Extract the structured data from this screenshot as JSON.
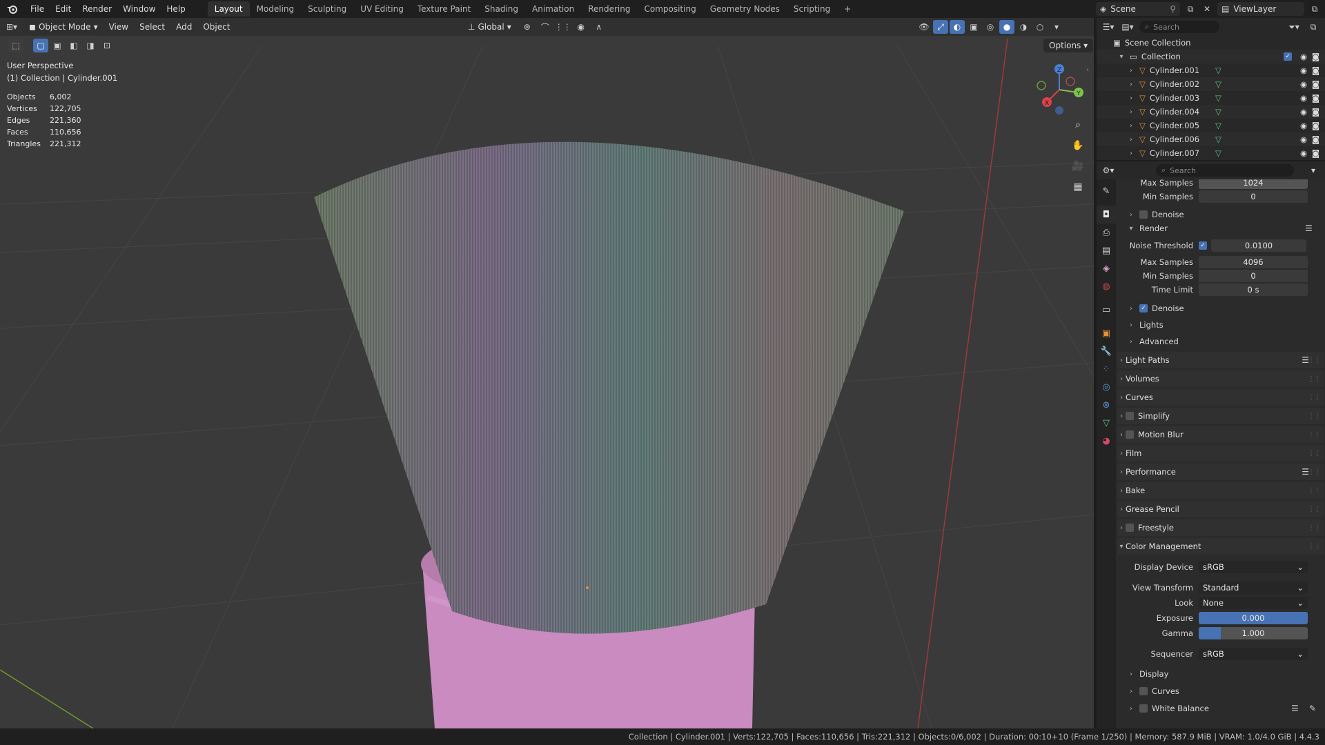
{
  "topbar": {
    "menus": [
      "File",
      "Edit",
      "Render",
      "Window",
      "Help"
    ],
    "workspaces": [
      "Layout",
      "Modeling",
      "Sculpting",
      "UV Editing",
      "Texture Paint",
      "Shading",
      "Animation",
      "Rendering",
      "Compositing",
      "Geometry Nodes",
      "Scripting"
    ],
    "active_workspace": "Layout",
    "add_tab": "+",
    "scene": "Scene",
    "view_layer": "ViewLayer"
  },
  "viewport_header": {
    "mode": "Object Mode",
    "menus": [
      "View",
      "Select",
      "Add",
      "Object"
    ],
    "transform_orientation": "Global",
    "options": "Options"
  },
  "viewport": {
    "perspective": "User Perspective",
    "collection_info": "(1) Collection | Cylinder.001",
    "stats": [
      {
        "label": "Objects",
        "value": "6,002"
      },
      {
        "label": "Vertices",
        "value": "122,705"
      },
      {
        "label": "Edges",
        "value": "221,360"
      },
      {
        "label": "Faces",
        "value": "110,656"
      },
      {
        "label": "Triangles",
        "value": "221,312"
      }
    ],
    "gizmo": {
      "x": "X",
      "y": "Y",
      "z": "Z"
    }
  },
  "outliner": {
    "search_placeholder": "Search",
    "scene_collection": "Scene Collection",
    "collection": "Collection",
    "objects": [
      "Cylinder.001",
      "Cylinder.002",
      "Cylinder.003",
      "Cylinder.004",
      "Cylinder.005",
      "Cylinder.006",
      "Cylinder.007"
    ]
  },
  "properties": {
    "search_placeholder": "Search",
    "top_partial": {
      "label": "Max Samples",
      "value": "1024"
    },
    "viewport_min_samples": {
      "label": "Min Samples",
      "value": "0"
    },
    "viewport_denoise": "Denoise",
    "render_panel": "Render",
    "noise_threshold": {
      "label": "Noise Threshold",
      "value": "0.0100",
      "checked": true
    },
    "max_samples": {
      "label": "Max Samples",
      "value": "4096"
    },
    "min_samples": {
      "label": "Min Samples",
      "value": "0"
    },
    "time_limit": {
      "label": "Time Limit",
      "value": "0 s"
    },
    "render_denoise": "Denoise",
    "lights": "Lights",
    "advanced": "Advanced",
    "panels": [
      "Light Paths",
      "Volumes",
      "Curves",
      "Simplify",
      "Motion Blur",
      "Film",
      "Performance",
      "Bake",
      "Grease Pencil",
      "Freestyle"
    ],
    "color_management": "Color Management",
    "display_device": {
      "label": "Display Device",
      "value": "sRGB"
    },
    "view_transform": {
      "label": "View Transform",
      "value": "Standard"
    },
    "look": {
      "label": "Look",
      "value": "None"
    },
    "exposure": {
      "label": "Exposure",
      "value": "0.000"
    },
    "gamma": {
      "label": "Gamma",
      "value": "1.000",
      "fill": 0.2
    },
    "sequencer": {
      "label": "Sequencer",
      "value": "sRGB"
    },
    "display": "Display",
    "curves": "Curves",
    "white_balance": "White Balance"
  },
  "statusbar": {
    "text": "Collection | Cylinder.001 | Verts:122,705 | Faces:110,656 | Tris:221,312 | Objects:0/6,002 | Duration: 00:10+10 (Frame 1/250) | Memory: 587.9 MiB | VRAM: 1.0/4.0 GiB | 4.4.3"
  },
  "colors": {
    "accent": "#4772b3",
    "handle": "#c98bc0",
    "object_orange": "#e8903a",
    "mesh_green": "#5fc48a"
  }
}
